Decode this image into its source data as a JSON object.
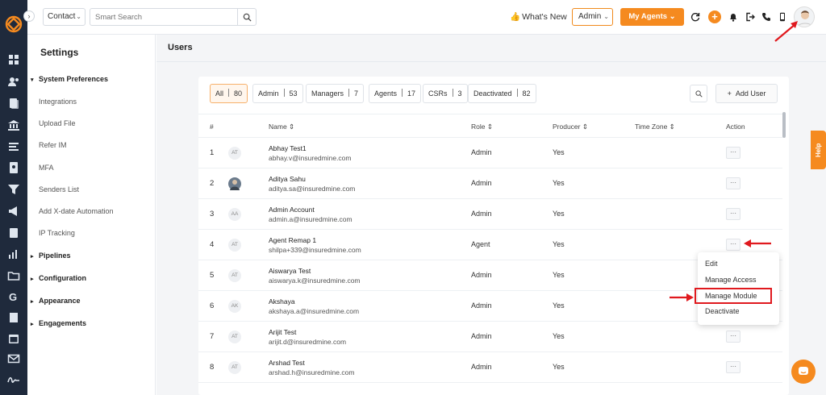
{
  "topbar": {
    "context_select": "Contact",
    "search_placeholder": "Smart Search",
    "whats_new": "What's New",
    "role_select": "Admin",
    "my_agents": "My Agents"
  },
  "settings": {
    "title": "Settings",
    "items": [
      {
        "label": "System Preferences",
        "section": true
      },
      {
        "label": "Integrations"
      },
      {
        "label": "Upload File"
      },
      {
        "label": "Refer IM"
      },
      {
        "label": "MFA"
      },
      {
        "label": "Senders List"
      },
      {
        "label": "Add X-date Automation"
      },
      {
        "label": "IP Tracking"
      },
      {
        "label": "Pipelines",
        "section": true
      },
      {
        "label": "Configuration",
        "section": true
      },
      {
        "label": "Appearance",
        "section": true
      },
      {
        "label": "Engagements",
        "section": true
      }
    ]
  },
  "main": {
    "title": "Users",
    "filters": [
      {
        "label": "All",
        "count": "80"
      },
      {
        "label": "Admin",
        "count": "53"
      },
      {
        "label": "Managers",
        "count": "7"
      },
      {
        "label": "Agents",
        "count": "17"
      },
      {
        "label": "CSRs",
        "count": "3"
      },
      {
        "label": "Deactivated",
        "count": "82"
      }
    ],
    "add_user": "Add User",
    "columns": {
      "num": "#",
      "name": "Name ⇕",
      "role": "Role ⇕",
      "producer": "Producer ⇕",
      "timezone": "Time Zone ⇕",
      "action": "Action"
    },
    "rows": [
      {
        "num": "1",
        "initials": "AT",
        "name": "Abhay Test1",
        "email": "abhay.v@insuredmine.com",
        "role": "Admin",
        "producer": "Yes",
        "action": "···"
      },
      {
        "num": "2",
        "initials": "",
        "name": "Aditya Sahu",
        "email": "aditya.sa@insuredmine.com",
        "role": "Admin",
        "producer": "Yes",
        "action": "···"
      },
      {
        "num": "3",
        "initials": "AA",
        "name": "Admin Account",
        "email": "admin.a@insuredmine.com",
        "role": "Admin",
        "producer": "Yes",
        "action": "···"
      },
      {
        "num": "4",
        "initials": "AT",
        "name": "Agent Remap 1",
        "email": "shilpa+339@insuredmine.com",
        "role": "Agent",
        "producer": "Yes",
        "action": "···"
      },
      {
        "num": "5",
        "initials": "AT",
        "name": "Aiswarya Test",
        "email": "aiswarya.k@insuredmine.com",
        "role": "Admin",
        "producer": "Yes",
        "action": "···"
      },
      {
        "num": "6",
        "initials": "AK",
        "name": "Akshaya",
        "email": "akshaya.a@insuredmine.com",
        "role": "Admin",
        "producer": "Yes",
        "action": "···"
      },
      {
        "num": "7",
        "initials": "AT",
        "name": "Arijit Test",
        "email": "arijit.d@insuredmine.com",
        "role": "Admin",
        "producer": "Yes",
        "action": "···"
      },
      {
        "num": "8",
        "initials": "AT",
        "name": "Arshad Test",
        "email": "arshad.h@insuredmine.com",
        "role": "Admin",
        "producer": "Yes",
        "action": "···"
      }
    ]
  },
  "action_menu": {
    "items": [
      "Edit",
      "Manage Access",
      "Manage Module",
      "Deactivate"
    ]
  },
  "help_tab": "Help",
  "colors": {
    "accent": "#f58a1f",
    "rail": "#1f2a3c",
    "highlight_box": "#e0191e"
  }
}
